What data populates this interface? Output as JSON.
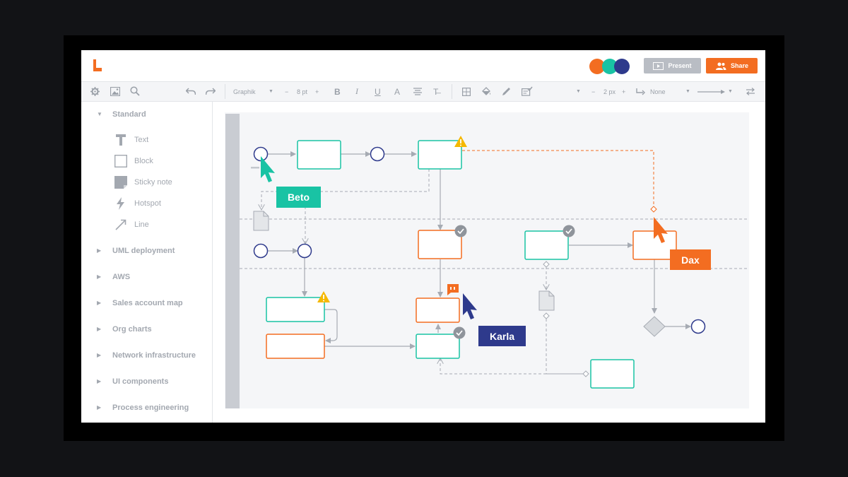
{
  "header": {
    "present_label": "Present",
    "share_label": "Share",
    "collaborators": [
      {
        "color": "#f36d21"
      },
      {
        "color": "#19c3a4"
      },
      {
        "color": "#2e3a8c"
      }
    ]
  },
  "toolbar": {
    "font_name": "Graphik",
    "font_size": "8 pt",
    "line_width": "2 px",
    "line_end": "None",
    "minus": "−",
    "plus": "+"
  },
  "sidebar": {
    "sections": [
      {
        "label": "Standard",
        "expanded": true
      },
      {
        "label": "UML deployment"
      },
      {
        "label": "AWS"
      },
      {
        "label": "Sales account map"
      },
      {
        "label": "Org charts"
      },
      {
        "label": "Network infrastructure"
      },
      {
        "label": "UI components"
      },
      {
        "label": "Process engineering"
      }
    ],
    "standard_items": [
      {
        "label": "Text",
        "icon": "text-icon"
      },
      {
        "label": "Block",
        "icon": "block-icon"
      },
      {
        "label": "Sticky note",
        "icon": "sticky-note-icon"
      },
      {
        "label": "Hotspot",
        "icon": "lightning-icon"
      },
      {
        "label": "Line",
        "icon": "line-icon"
      }
    ]
  },
  "collaborator_cursors": [
    {
      "name": "Beto",
      "color": "#19c3a4"
    },
    {
      "name": "Dax",
      "color": "#f36d21"
    },
    {
      "name": "Karla",
      "color": "#2e3a8c"
    }
  ],
  "colors": {
    "teal": "#19c3a4",
    "orange": "#f36d21",
    "navy": "#2e3a8c",
    "warning": "#f5b800"
  }
}
